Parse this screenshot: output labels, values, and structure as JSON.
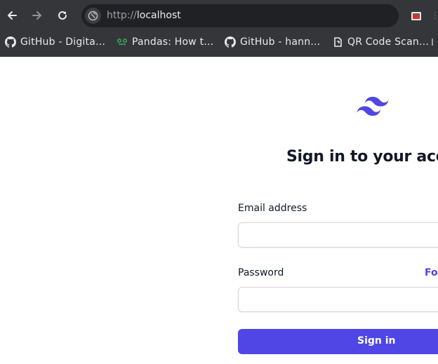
{
  "browser": {
    "url_scheme": "http://",
    "url_host": "localhost",
    "bookmarks": [
      {
        "label": "GitHub - Digita…",
        "icon": "github-icon"
      },
      {
        "label": "Pandas: How t…",
        "icon": "site-icon"
      },
      {
        "label": "GitHub - hann…",
        "icon": "github-icon"
      },
      {
        "label": "QR Code Scan…",
        "icon": "qr-site-icon"
      }
    ]
  },
  "page": {
    "title": "Sign in to your account",
    "email_label": "Email address",
    "password_label": "Password",
    "forgot_link": "Forgot password?",
    "signin_button": "Sign in",
    "accent_color": "#4f46e5"
  }
}
